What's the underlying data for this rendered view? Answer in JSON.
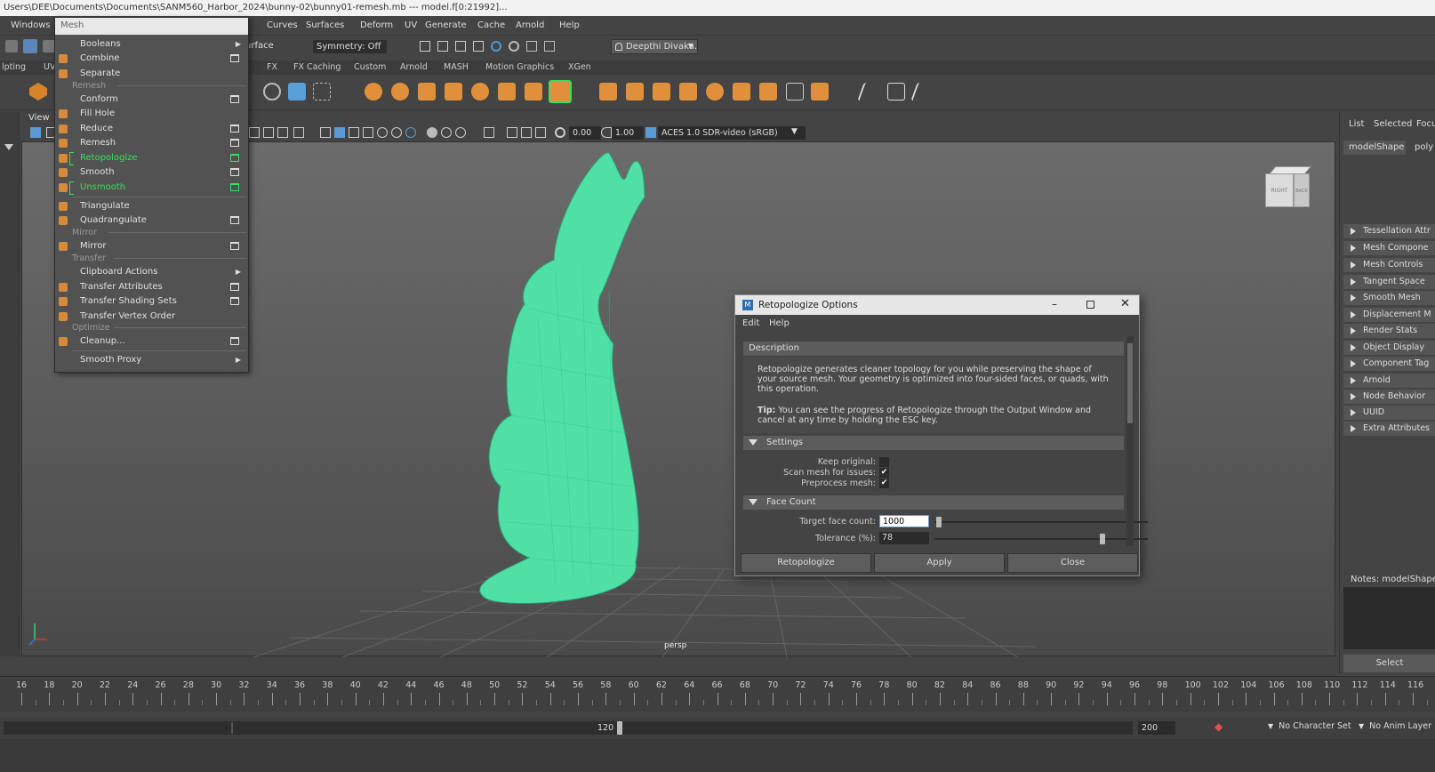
{
  "window": {
    "title": "Users\\DEE\\Documents\\Documents\\SANM560_Harbor_2024\\bunny-02\\bunny01-remesh.mb   ---   model.f[0:21992]..."
  },
  "menubar": {
    "items": [
      "Windows",
      "Curves",
      "Surfaces",
      "Deform",
      "UV",
      "Generate",
      "Cache",
      "Arnold",
      "Help"
    ]
  },
  "status_line": {
    "surface_field": "urface",
    "symmetry": "Symmetry: Off",
    "user": "Deepthi Divaka."
  },
  "shelf_tabs": [
    "lpting",
    "UV",
    "FX",
    "FX Caching",
    "Custom",
    "Arnold",
    "MASH",
    "Motion Graphics",
    "XGen"
  ],
  "mesh_menu": {
    "title": "Mesh",
    "items": [
      {
        "label": "Booleans"
      },
      {
        "label": "Combine"
      },
      {
        "label": "Separate"
      },
      {
        "label": "Conform"
      },
      {
        "label": "Fill Hole"
      },
      {
        "label": "Reduce"
      },
      {
        "label": "Remesh"
      },
      {
        "label": "Retopologize"
      },
      {
        "label": "Smooth"
      },
      {
        "label": "Unsmooth"
      },
      {
        "label": "Triangulate"
      },
      {
        "label": "Quadrangulate"
      },
      {
        "label": "Mirror"
      },
      {
        "label": "Clipboard Actions"
      },
      {
        "label": "Transfer Attributes"
      },
      {
        "label": "Transfer Shading Sets"
      },
      {
        "label": "Transfer Vertex Order"
      },
      {
        "label": "Cleanup..."
      },
      {
        "label": "Smooth Proxy"
      }
    ],
    "sections": [
      "Remesh",
      "Mirror",
      "Transfer",
      "Optimize"
    ]
  },
  "viewport": {
    "panel_menu": "View",
    "exposure": "0.00",
    "gamma": "1.00",
    "color_space": "ACES 1.0 SDR-video (sRGB)",
    "camera_label": "persp",
    "viewcube_right": "RIGHT",
    "viewcube_back": "BACK"
  },
  "dialog": {
    "title": "Retopologize Options",
    "menu": [
      "Edit",
      "Help"
    ],
    "description_header": "Description",
    "description_text": "Retopologize generates cleaner topology for you while preserving the shape of your source mesh. Your geometry is optimized into four-sided faces, or quads, with this operation.",
    "tip_bold": "Tip:",
    "tip_text": " You can see the progress of Retopologize through the Output Window and cancel at any time by holding the ESC key.",
    "settings_header": "Settings",
    "keep_original_label": "Keep original:",
    "scan_mesh_label": "Scan mesh for issues:",
    "preprocess_label": "Preprocess mesh:",
    "keep_original": false,
    "scan_mesh": true,
    "preprocess": true,
    "face_count_header": "Face Count",
    "target_face_label": "Target face count:",
    "target_face_value": "1000",
    "tolerance_label": "Tolerance (%):",
    "tolerance_value": "78",
    "buttons": {
      "retopologize": "Retopologize",
      "apply": "Apply",
      "close": "Close"
    }
  },
  "attribute_editor": {
    "tabs": [
      "List",
      "Selected",
      "Focus"
    ],
    "node_tab": "modelShape",
    "node_tab2": "poly",
    "sections": [
      "Tessellation Attr",
      "Mesh Compone",
      "Mesh Controls",
      "Tangent Space",
      "Smooth Mesh",
      "Displacement M",
      "Render Stats",
      "Object Display",
      "Component Tag",
      "Arnold",
      "Node Behavior",
      "UUID",
      "Extra Attributes"
    ],
    "notes_label": "Notes:  modelShape",
    "select_button": "Select"
  },
  "timeline": {
    "ticks": [
      "16",
      "18",
      "20",
      "22",
      "24",
      "26",
      "28",
      "30",
      "32",
      "34",
      "36",
      "38",
      "40",
      "42",
      "44",
      "46",
      "48",
      "50",
      "52",
      "54",
      "56",
      "58",
      "60",
      "62",
      "64",
      "66",
      "68",
      "70",
      "72",
      "74",
      "76",
      "78",
      "80",
      "82",
      "84",
      "86",
      "88",
      "90",
      "92",
      "94",
      "96",
      "98",
      "100",
      "102",
      "104",
      "106",
      "108",
      "110",
      "112",
      "114",
      "116"
    ]
  },
  "range": {
    "current": "120",
    "end": "200",
    "character_set": "No Character Set",
    "anim_layer": "No Anim Layer"
  },
  "colors": {
    "accent_green": "#35e05a",
    "mesh_green": "#4fe0a6",
    "maya_bg": "#444444"
  }
}
